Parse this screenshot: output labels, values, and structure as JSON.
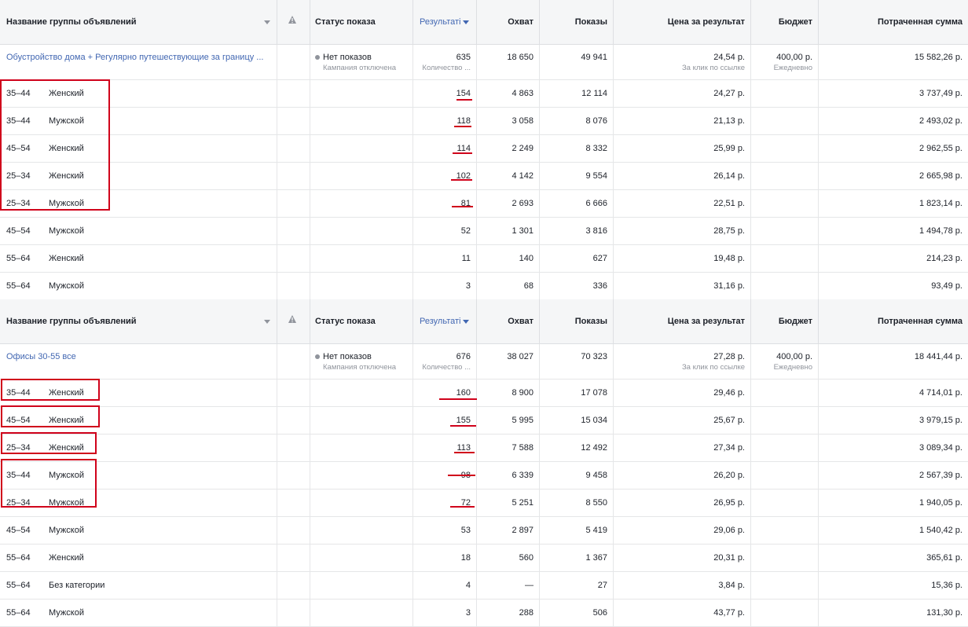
{
  "columns": {
    "name": "Название группы объявлений",
    "status": "Статус показа",
    "results": "Результаті",
    "reach": "Охват",
    "impressions": "Показы",
    "cost_per_result": "Цена за результат",
    "budget": "Бюджет",
    "spent": "Потраченная сумма"
  },
  "tables": [
    {
      "summary": {
        "name": "Обустройство дома + Регулярно путешествующие за границу ...",
        "status": "Нет показов",
        "status_sub": "Кампания отключена",
        "results": "635",
        "results_sub": "Количество ...",
        "reach": "18 650",
        "impressions": "49 941",
        "cost_per_result": "24,54 р.",
        "cost_sub": "За клик по ссылке",
        "budget": "400,00 р.",
        "budget_sub": "Ежедневно",
        "spent": "15 582,26 р."
      },
      "rows": [
        {
          "age": "35–44",
          "gender": "Женский",
          "results": "154",
          "reach": "4 863",
          "impressions": "12 114",
          "cost": "24,27 р.",
          "spent": "3 737,49 р."
        },
        {
          "age": "35–44",
          "gender": "Мужской",
          "results": "118",
          "reach": "3 058",
          "impressions": "8 076",
          "cost": "21,13 р.",
          "spent": "2 493,02 р."
        },
        {
          "age": "45–54",
          "gender": "Женский",
          "results": "114",
          "reach": "2 249",
          "impressions": "8 332",
          "cost": "25,99 р.",
          "spent": "2 962,55 р."
        },
        {
          "age": "25–34",
          "gender": "Женский",
          "results": "102",
          "reach": "4 142",
          "impressions": "9 554",
          "cost": "26,14 р.",
          "spent": "2 665,98 р."
        },
        {
          "age": "25–34",
          "gender": "Мужской",
          "results": "81",
          "reach": "2 693",
          "impressions": "6 666",
          "cost": "22,51 р.",
          "spent": "1 823,14 р."
        },
        {
          "age": "45–54",
          "gender": "Мужской",
          "results": "52",
          "reach": "1 301",
          "impressions": "3 816",
          "cost": "28,75 р.",
          "spent": "1 494,78 р."
        },
        {
          "age": "55–64",
          "gender": "Женский",
          "results": "11",
          "reach": "140",
          "impressions": "627",
          "cost": "19,48 р.",
          "spent": "214,23 р."
        },
        {
          "age": "55–64",
          "gender": "Мужской",
          "results": "3",
          "reach": "68",
          "impressions": "336",
          "cost": "31,16 р.",
          "spent": "93,49 р."
        }
      ]
    },
    {
      "summary": {
        "name": "Офисы 30-55 все",
        "status": "Нет показов",
        "status_sub": "Кампания отключена",
        "results": "676",
        "results_sub": "Количество ...",
        "reach": "38 027",
        "impressions": "70 323",
        "cost_per_result": "27,28 р.",
        "cost_sub": "За клик по ссылке",
        "budget": "400,00 р.",
        "budget_sub": "Ежедневно",
        "spent": "18 441,44 р."
      },
      "rows": [
        {
          "age": "35–44",
          "gender": "Женский",
          "results": "160",
          "reach": "8 900",
          "impressions": "17 078",
          "cost": "29,46 р.",
          "spent": "4 714,01 р."
        },
        {
          "age": "45–54",
          "gender": "Женский",
          "results": "155",
          "reach": "5 995",
          "impressions": "15 034",
          "cost": "25,67 р.",
          "spent": "3 979,15 р."
        },
        {
          "age": "25–34",
          "gender": "Женский",
          "results": "113",
          "reach": "7 588",
          "impressions": "12 492",
          "cost": "27,34 р.",
          "spent": "3 089,34 р."
        },
        {
          "age": "35–44",
          "gender": "Мужской",
          "results": "98",
          "reach": "6 339",
          "impressions": "9 458",
          "cost": "26,20 р.",
          "spent": "2 567,39 р."
        },
        {
          "age": "25–34",
          "gender": "Мужской",
          "results": "72",
          "reach": "5 251",
          "impressions": "8 550",
          "cost": "26,95 р.",
          "spent": "1 940,05 р."
        },
        {
          "age": "45–54",
          "gender": "Мужской",
          "results": "53",
          "reach": "2 897",
          "impressions": "5 419",
          "cost": "29,06 р.",
          "spent": "1 540,42 р."
        },
        {
          "age": "55–64",
          "gender": "Женский",
          "results": "18",
          "reach": "560",
          "impressions": "1 367",
          "cost": "20,31 р.",
          "spent": "365,61 р."
        },
        {
          "age": "55–64",
          "gender": "Без категории",
          "results": "4",
          "reach": "—",
          "impressions": "27",
          "cost": "3,84 р.",
          "spent": "15,36 р."
        },
        {
          "age": "55–64",
          "gender": "Мужской",
          "results": "3",
          "reach": "288",
          "impressions": "506",
          "cost": "43,77 р.",
          "spent": "131,30 р."
        }
      ]
    }
  ],
  "icons": {
    "sort": "chevron-down-icon",
    "warning": "warning-icon",
    "status_dot": "status-dot-icon"
  },
  "colors": {
    "highlight": "#d0021b",
    "link": "#4267b2",
    "header_bg": "#f5f6f7"
  }
}
